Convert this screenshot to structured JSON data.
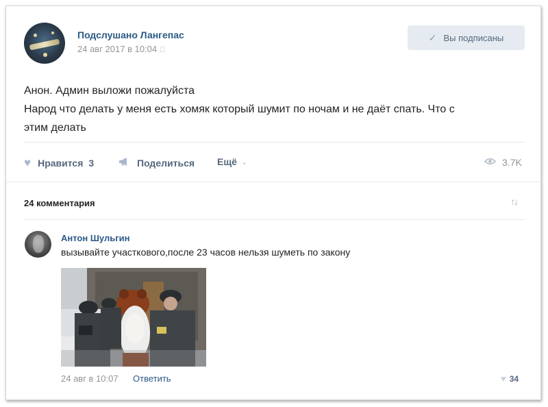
{
  "post": {
    "group_name": "Подслушано Лангепас",
    "date": "24 авг 2017 в 10:04",
    "platform_icon": "apple-icon",
    "subscribe_label": "Вы подписаны",
    "text_lines": [
      "Анон. Админ выложи пожалуйста",
      "Народ что делать у меня есть хомяк который шумит по ночам и не даёт спать. Что с",
      "этим делать"
    ],
    "actions": {
      "like_label": "Нравится",
      "like_count": "3",
      "share_label": "Поделиться",
      "more_label": "Ещё",
      "views": "3.7K"
    }
  },
  "comments": {
    "count_label": "24 комментария",
    "items": [
      {
        "author": "Антон Шульгин",
        "text": "вызывайте участкового,после 23 часов нельзя шуметь по закону",
        "date": "24 авг в 10:07",
        "reply_label": "Ответить",
        "likes": "34"
      }
    ]
  },
  "colors": {
    "link": "#2a5885",
    "muted": "#939393",
    "action": "#55677d",
    "button_bg": "#e5ebf1"
  }
}
